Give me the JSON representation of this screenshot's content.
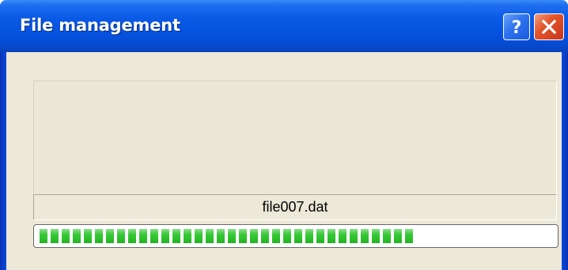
{
  "window": {
    "title": "File management",
    "help_button": "?",
    "close_button": "✕"
  },
  "status": {
    "current_file": "file007.dat"
  },
  "progress": {
    "value_percent": 73
  },
  "colors": {
    "titlebar": "#0550dd",
    "client_bg": "#ece9d8",
    "progress_fill": "#2fc52e",
    "close_button": "#e2542a"
  },
  "icons": {
    "help": "help-icon",
    "close": "close-icon"
  }
}
